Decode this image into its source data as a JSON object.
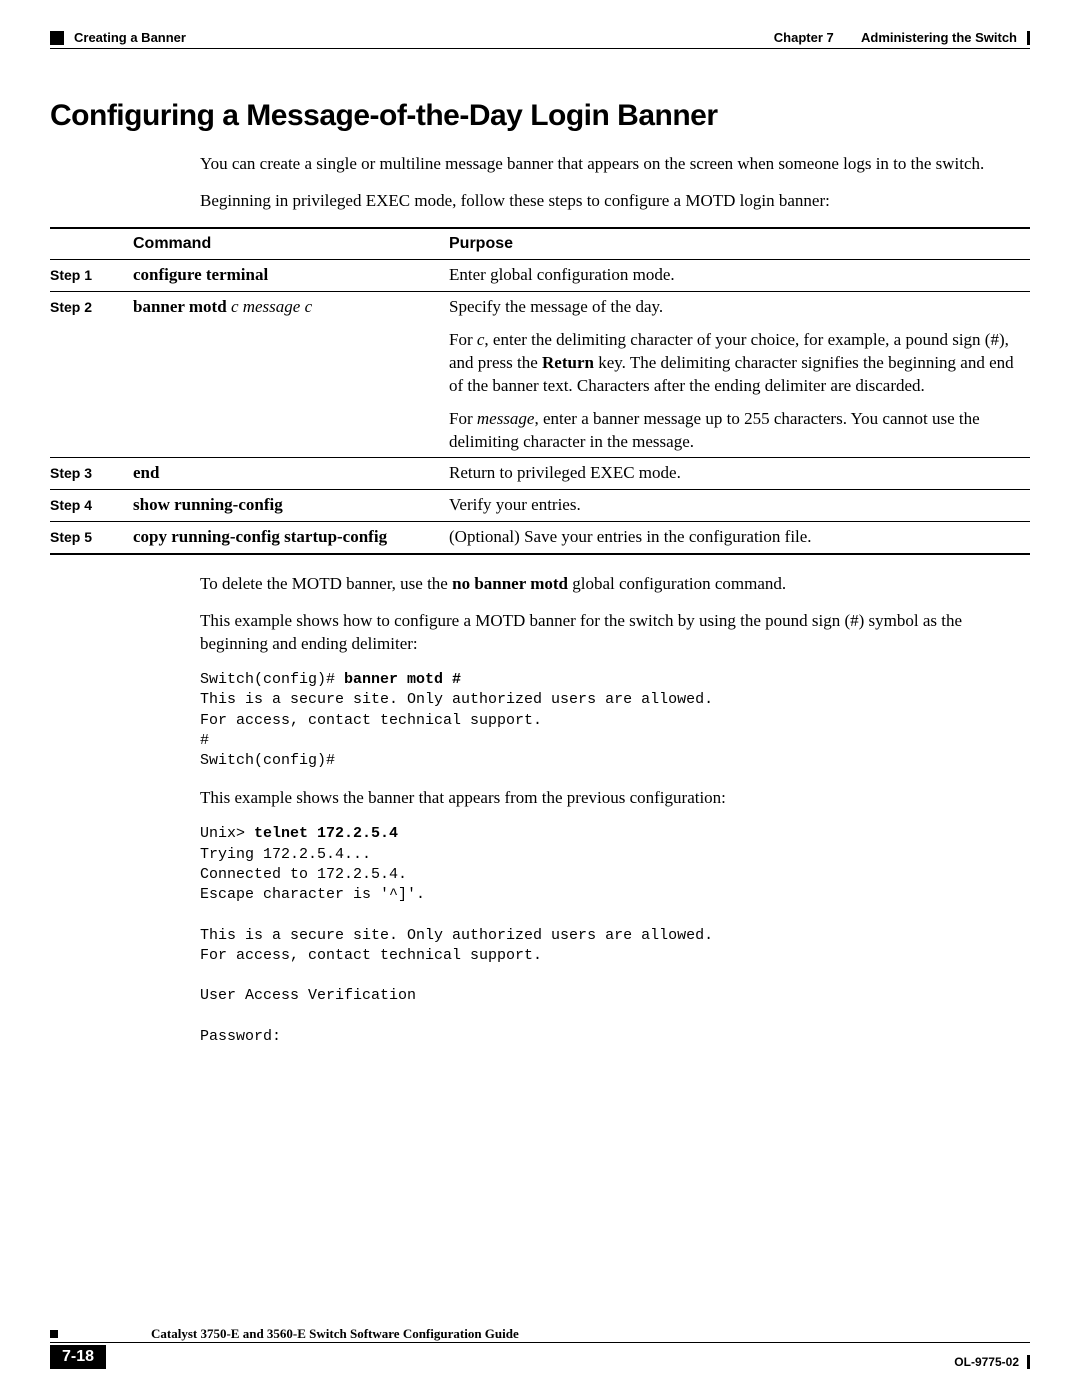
{
  "header": {
    "section": "Creating a Banner",
    "chapter": "Chapter 7",
    "chapter_title": "Administering the Switch"
  },
  "title": "Configuring a Message-of-the-Day Login Banner",
  "intro_p1": "You can create a single or multiline message banner that appears on the screen when someone logs in to the switch.",
  "intro_p2": "Beginning in privileged EXEC mode, follow these steps to configure a MOTD login banner:",
  "table": {
    "col_step": "",
    "col_command": "Command",
    "col_purpose": "Purpose",
    "rows": [
      {
        "step": "Step 1",
        "cmd_b": "configure terminal",
        "cmd_i": "",
        "purpose1": "Enter global configuration mode."
      },
      {
        "step": "Step 2",
        "cmd_b": "banner motd",
        "cmd_i": " c message c",
        "purpose1": "Specify the message of the day.",
        "purpose2a": "For ",
        "purpose2b_i": "c",
        "purpose2c": ", enter the delimiting character of your choice, for example, a pound sign (#), and press the ",
        "purpose2d_b": "Return",
        "purpose2e": " key. The delimiting character signifies the beginning and end of the banner text. Characters after the ending delimiter are discarded.",
        "purpose3a": "For ",
        "purpose3b_i": "message",
        "purpose3c": ", enter a banner message up to 255 characters. You cannot use the delimiting character in the message."
      },
      {
        "step": "Step 3",
        "cmd_b": "end",
        "cmd_i": "",
        "purpose1": "Return to privileged EXEC mode."
      },
      {
        "step": "Step 4",
        "cmd_b": "show running-config",
        "cmd_i": "",
        "purpose1": "Verify your entries."
      },
      {
        "step": "Step 5",
        "cmd_b": "copy running-config startup-config",
        "cmd_i": "",
        "purpose1": "(Optional) Save your entries in the configuration file."
      }
    ]
  },
  "after1a": "To delete the MOTD banner, use the ",
  "after1b_b": "no banner motd",
  "after1c": " global configuration command.",
  "after2": "This example shows how to configure a MOTD banner for the switch by using the pound sign (#) symbol as the beginning and ending delimiter:",
  "code1_l1a": "Switch(config)# ",
  "code1_l1b": "banner motd #",
  "code1_l2": "This is a secure site. Only authorized users are allowed.",
  "code1_l3": "For access, contact technical support.",
  "code1_l4": "#",
  "code1_l5": "Switch(config)#",
  "after3": "This example shows the banner that appears from the previous configuration:",
  "code2_l1a": "Unix> ",
  "code2_l1b": "telnet 172.2.5.4",
  "code2_l2": "Trying 172.2.5.4...",
  "code2_l3": "Connected to 172.2.5.4.",
  "code2_l4": "Escape character is '^]'.",
  "code2_l5": "",
  "code2_l6": "This is a secure site. Only authorized users are allowed.",
  "code2_l7": "For access, contact technical support.",
  "code2_l8": "",
  "code2_l9": "User Access Verification",
  "code2_l10": "",
  "code2_l11": "Password:",
  "footer": {
    "guide": "Catalyst 3750-E and 3560-E Switch Software Configuration Guide",
    "page": "7-18",
    "doc": "OL-9775-02"
  }
}
